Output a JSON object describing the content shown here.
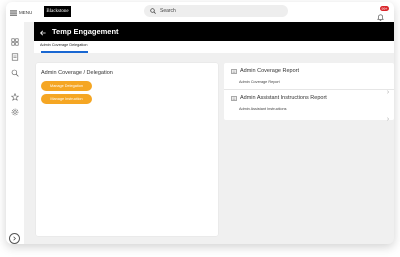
{
  "topbar": {
    "menu_label": "MENU",
    "logo_text": "Blackstone",
    "search_placeholder": "Search",
    "notification_count": "99+"
  },
  "page": {
    "title": "Temp Engagement",
    "tab_label": "Admin Coverage Delegation"
  },
  "left_card": {
    "title": "Admin Coverage / Delegation",
    "buttons": [
      "Manage Delegation",
      "Manage Instruction"
    ]
  },
  "right_card": {
    "sections": [
      {
        "title": "Admin Coverage Report",
        "link": "Admin Coverage Report"
      },
      {
        "title": "Admin Assistant Instructions Report",
        "link": "Admin Assistant Instructions"
      }
    ]
  },
  "colors": {
    "accent_orange": "#f5a623",
    "tab_underline": "#1967d2",
    "badge_red": "#d9252a",
    "header_black": "#000000"
  }
}
